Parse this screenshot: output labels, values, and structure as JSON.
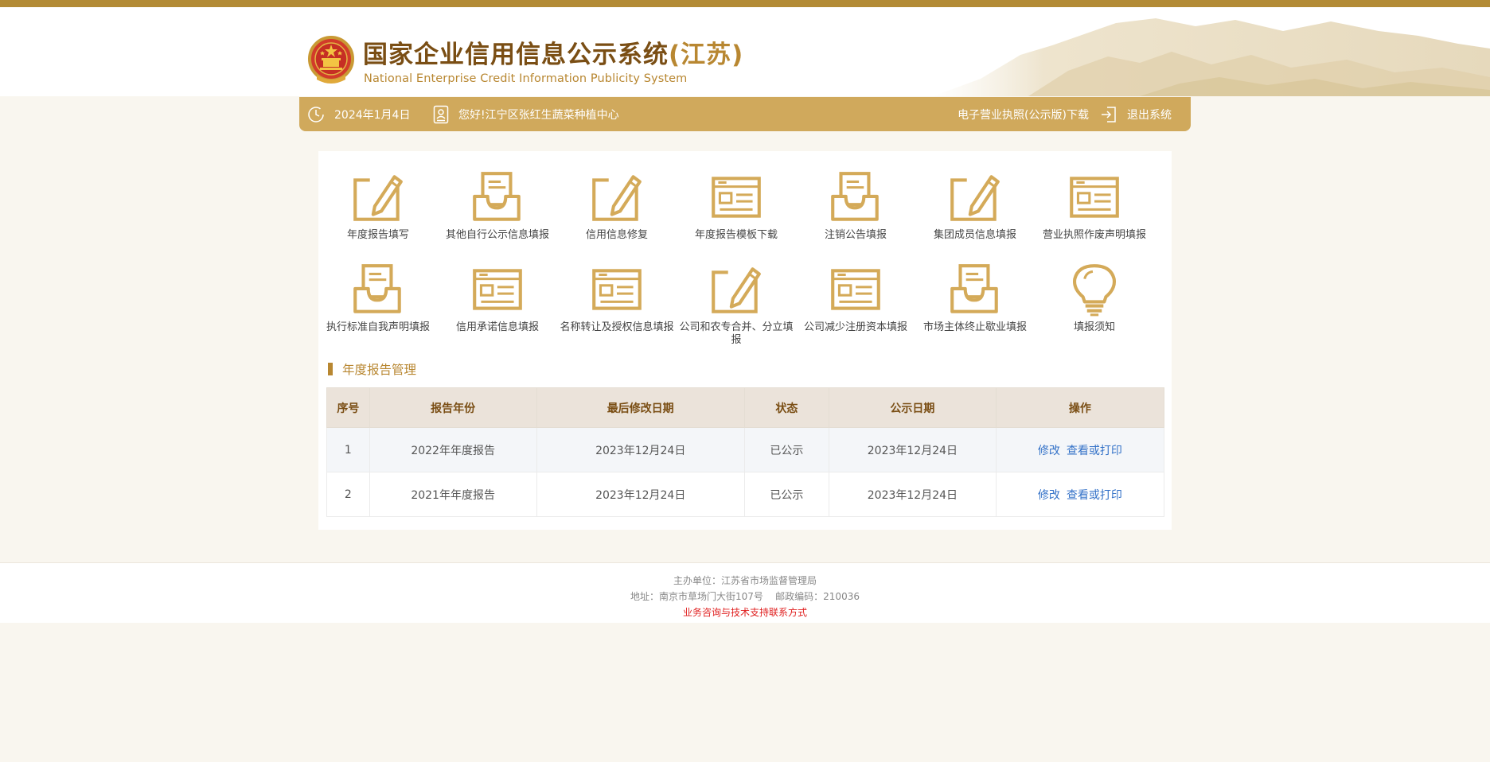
{
  "header": {
    "title": "国家企业信用信息公示系统",
    "province": "(江苏)",
    "subtitle": "National Enterprise Credit Information Publicity System"
  },
  "nav": {
    "date": "2024年1月4日",
    "greeting": "您好!江宁区张红生蔬菜种植中心",
    "download_license": "电子营业执照(公示版)下载",
    "logout": "退出系统"
  },
  "menu": [
    {
      "label": "年度报告填写",
      "icon": "edit-icon"
    },
    {
      "label": "其他自行公示信息填报",
      "icon": "inbox-icon"
    },
    {
      "label": "信用信息修复",
      "icon": "edit-icon"
    },
    {
      "label": "年度报告模板下载",
      "icon": "form-icon"
    },
    {
      "label": "注销公告填报",
      "icon": "inbox-icon"
    },
    {
      "label": "集团成员信息填报",
      "icon": "edit-icon"
    },
    {
      "label": "营业执照作废声明填报",
      "icon": "form-icon"
    },
    {
      "label": "执行标准自我声明填报",
      "icon": "inbox-icon"
    },
    {
      "label": "信用承诺信息填报",
      "icon": "form-icon"
    },
    {
      "label": "名称转让及授权信息填报",
      "icon": "form-icon"
    },
    {
      "label": "公司和农专合并、分立填报",
      "icon": "edit-icon"
    },
    {
      "label": "公司减少注册资本填报",
      "icon": "form-icon"
    },
    {
      "label": "市场主体终止歇业填报",
      "icon": "inbox-icon"
    },
    {
      "label": "填报须知",
      "icon": "lightbulb-icon"
    }
  ],
  "section": {
    "title": "年度报告管理"
  },
  "table": {
    "headers": [
      "序号",
      "报告年份",
      "最后修改日期",
      "状态",
      "公示日期",
      "操作"
    ],
    "rows": [
      {
        "no": "1",
        "year": "2022年年度报告",
        "modified": "2023年12月24日",
        "status": "已公示",
        "publish": "2023年12月24日",
        "edit": "修改",
        "view": "查看或打印"
      },
      {
        "no": "2",
        "year": "2021年年度报告",
        "modified": "2023年12月24日",
        "status": "已公示",
        "publish": "2023年12月24日",
        "edit": "修改",
        "view": "查看或打印"
      }
    ]
  },
  "footer": {
    "sponsor": "主办单位：江苏省市场监督管理局",
    "address": "地址：南京市草场门大街107号    邮政编码：210036",
    "contact": "业务咨询与技术支持联系方式"
  },
  "colors": {
    "accent": "#b88731",
    "nav_bg": "#d0a95c",
    "top_strip": "#b38b36",
    "link": "#3472c8",
    "contact": "#e02020"
  }
}
